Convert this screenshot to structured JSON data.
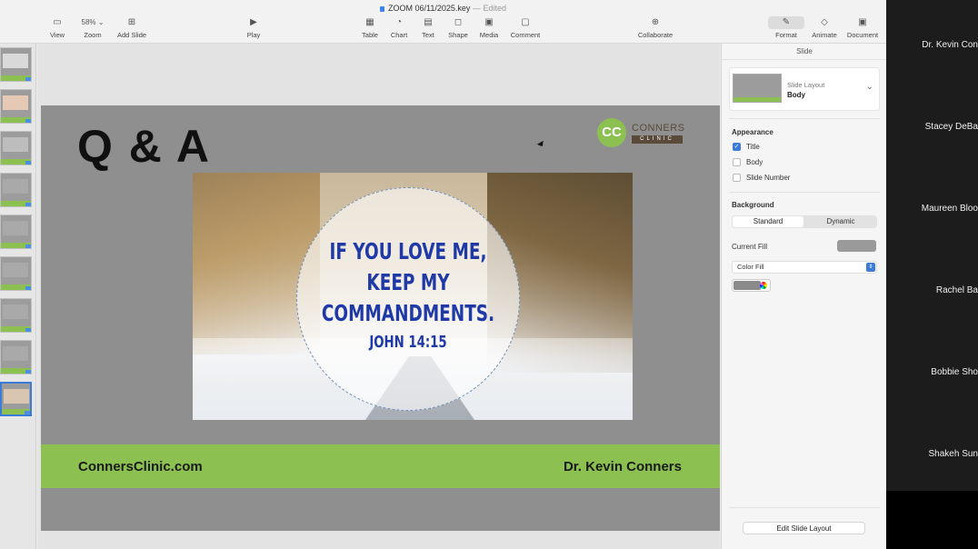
{
  "window": {
    "document_title": "ZOOM 06/11/2025.key",
    "status": "Edited",
    "separator": "—"
  },
  "toolbar": {
    "view": "View",
    "zoom_value": "58%",
    "zoom": "Zoom",
    "add_slide": "Add Slide",
    "play": "Play",
    "table": "Table",
    "chart": "Chart",
    "text": "Text",
    "shape": "Shape",
    "media": "Media",
    "comment": "Comment",
    "collaborate": "Collaborate",
    "format": "Format",
    "animate": "Animate",
    "document": "Document"
  },
  "slide": {
    "title": "Q & A",
    "logo_initials": "CC",
    "logo_name": "CONNERS",
    "logo_sub": "CLINIC",
    "quote_lines": [
      "IF YOU LOVE ME,",
      "KEEP MY",
      "COMMANDMENTS."
    ],
    "quote_ref": "JOHN 14:15",
    "footer_left": "ConnersClinic.com",
    "footer_right": "Dr. Kevin Conners"
  },
  "inspector": {
    "tab": "Slide",
    "layout_label": "Slide Layout",
    "layout_name": "Body",
    "appearance_heading": "Appearance",
    "appearance_options": [
      {
        "label": "Title",
        "checked": true
      },
      {
        "label": "Body",
        "checked": false
      },
      {
        "label": "Slide Number",
        "checked": false
      }
    ],
    "background_heading": "Background",
    "background_tabs": [
      "Standard",
      "Dynamic"
    ],
    "current_fill_label": "Current Fill",
    "fill_type": "Color Fill",
    "edit_layout_button": "Edit Slide Layout"
  },
  "participants": [
    "Dr. Kevin Con",
    "Stacey DeBa",
    "Maureen Bloo",
    "Rachel Ba",
    "Bobbie Sho",
    "Shakeh Sun"
  ],
  "colors": {
    "brand_green": "#8cc152",
    "quote_blue": "#1f3aa6",
    "slide_gray": "#8f8f8f",
    "selection_blue": "#3d7bd8"
  }
}
